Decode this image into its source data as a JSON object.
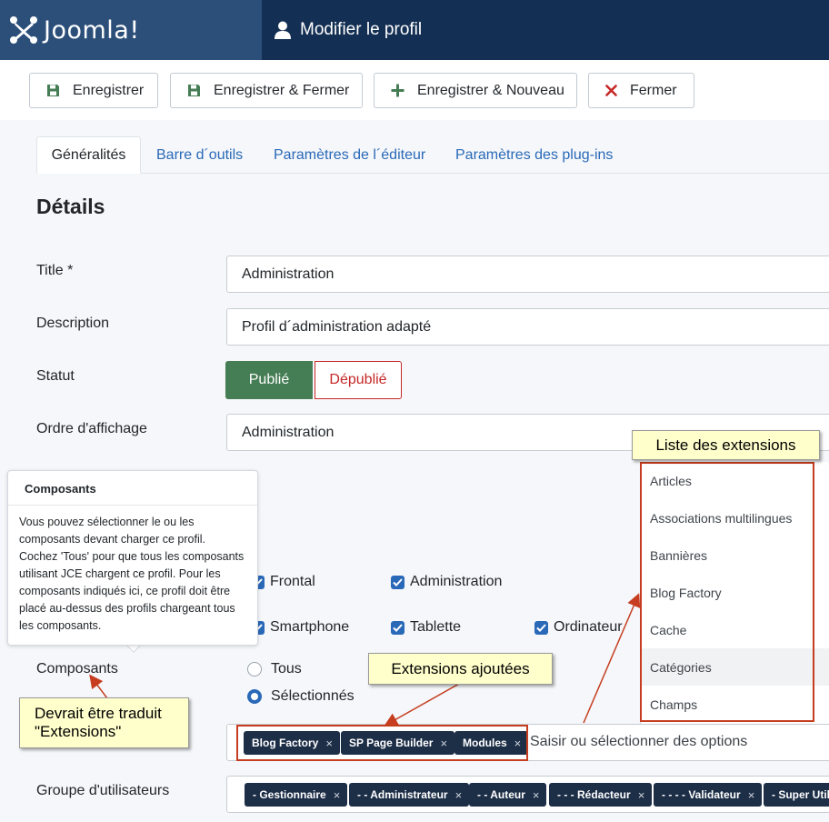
{
  "header": {
    "logo_text": "Joomla!",
    "title": "Modifier le profil"
  },
  "toolbar": {
    "save_label": "Enregistrer",
    "save_close_label": "Enregistrer & Fermer",
    "save_new_label": "Enregistrer & Nouveau",
    "close_label": "Fermer"
  },
  "tabs": [
    {
      "label": "Généralités"
    },
    {
      "label": "Barre d´outils"
    },
    {
      "label": "Paramètres de l´éditeur"
    },
    {
      "label": "Paramètres des plug-ins"
    }
  ],
  "section_title": "Détails",
  "form": {
    "title_label": "Title *",
    "title_value": "Administration",
    "description_label": "Description",
    "description_value": "Profil d´administration adapté",
    "status_label": "Statut",
    "status_published": "Publié",
    "status_unpublished": "Dépublié",
    "order_label": "Ordre d'affichage",
    "order_value": "Administration",
    "components_label": "Composants",
    "usergroup_label": "Groupe d'utilisateurs"
  },
  "tooltip": {
    "title": "Composants",
    "body": "Vous pouvez sélectionner le ou les composants devant charger ce profil. Cochez 'Tous' pour que tous les composants utilisant JCE chargent ce profil. Pour les composants indiqués ici, ce profil doit être placé au-dessus des profils chargeant tous les composants."
  },
  "checkboxes": {
    "frontal": "Frontal",
    "administration": "Administration",
    "smartphone": "Smartphone",
    "tablette": "Tablette",
    "ordinateur": "Ordinateur"
  },
  "radios": {
    "all": "Tous",
    "selected": "Sélectionnés"
  },
  "components_chips": [
    "Blog Factory",
    "SP Page Builder",
    "Modules"
  ],
  "components_placeholder": "Saisir ou sélectionner des options",
  "usergroup_chips": [
    "- Gestionnaire",
    "- - Administrateur",
    "- - Auteur",
    "- - - Rédacteur",
    "- - - - Validateur",
    "- Super Utili"
  ],
  "dropdown_items": [
    "Articles",
    "Associations multilingues",
    "Bannières",
    "Blog Factory",
    "Cache",
    "Catégories",
    "Champs"
  ],
  "annotations": {
    "extensions_list": "Liste des extensions",
    "added_extensions": "Extensions ajoutées",
    "translation_note_line1": "Devrait être traduit",
    "translation_note_line2": "\"Extensions\""
  },
  "colors": {
    "header_bg": "#132f53",
    "logo_bg": "#2c4f7a",
    "success": "#457d54",
    "danger": "#c52827",
    "link": "#2a69b8",
    "chip_bg": "#1d2e47",
    "annotation_red": "#c63d1f",
    "note_bg": "#ffffcc"
  }
}
